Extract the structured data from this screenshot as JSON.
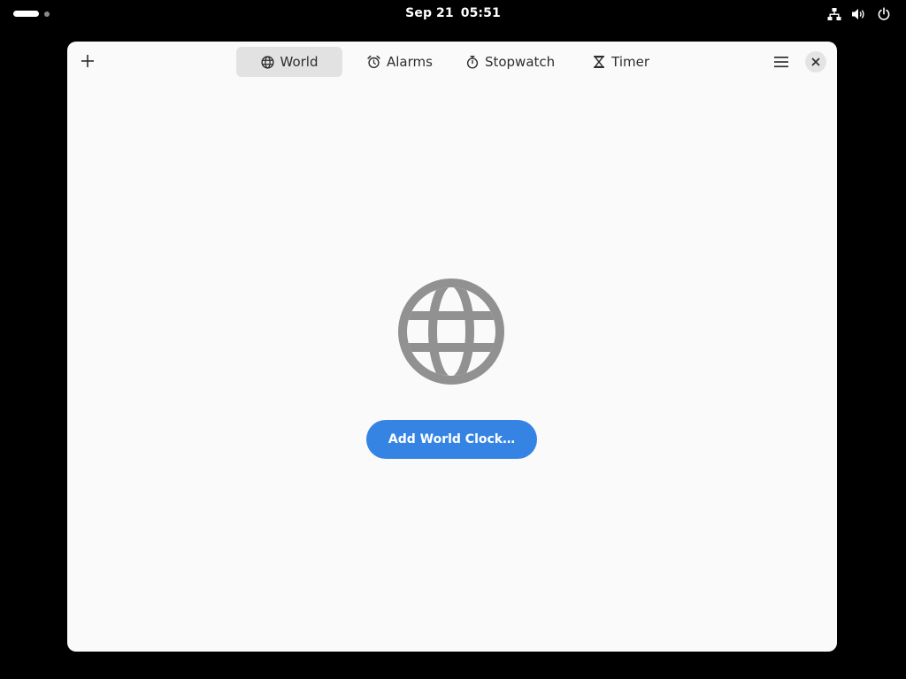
{
  "topbar": {
    "date": "Sep 21",
    "time": "05:51",
    "icons": [
      "workspace-indicator",
      "network-wired-icon",
      "volume-icon",
      "power-icon"
    ]
  },
  "window": {
    "tabs": [
      {
        "label": "World",
        "icon": "globe-icon",
        "active": true
      },
      {
        "label": "Alarms",
        "icon": "alarm-icon",
        "active": false
      },
      {
        "label": "Stopwatch",
        "icon": "stopwatch-icon",
        "active": false
      },
      {
        "label": "Timer",
        "icon": "hourglass-icon",
        "active": false
      }
    ],
    "header_icons": [
      "add-icon",
      "hamburger-menu-icon",
      "close-icon"
    ]
  },
  "empty_state": {
    "icon": "globe-icon",
    "button_label": "Add World Clock…"
  },
  "colors": {
    "accent": "#3584e4",
    "window_bg": "#fafafa",
    "active_tab_bg": "#e2e2e2",
    "empty_icon": "#919191"
  }
}
